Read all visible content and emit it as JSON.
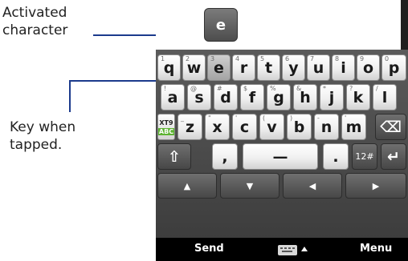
{
  "annotations": {
    "activated": [
      "Activated",
      "character"
    ],
    "key_tapped": [
      "Key when",
      "tapped."
    ]
  },
  "popup_char": "e",
  "keyboard": {
    "row1": [
      {
        "letter": "q",
        "num": "1"
      },
      {
        "letter": "w",
        "num": "2"
      },
      {
        "letter": "e",
        "num": "3"
      },
      {
        "letter": "r",
        "num": "4"
      },
      {
        "letter": "t",
        "num": "5"
      },
      {
        "letter": "y",
        "num": "6"
      },
      {
        "letter": "u",
        "num": "7"
      },
      {
        "letter": "i",
        "num": "8"
      },
      {
        "letter": "o",
        "num": "9"
      },
      {
        "letter": "p",
        "num": "0"
      }
    ],
    "row2": [
      {
        "letter": "a",
        "num": "!"
      },
      {
        "letter": "s",
        "num": "@"
      },
      {
        "letter": "d",
        "num": "#"
      },
      {
        "letter": "f",
        "num": "$"
      },
      {
        "letter": "g",
        "num": "%"
      },
      {
        "letter": "h",
        "num": "&"
      },
      {
        "letter": "j",
        "num": "*"
      },
      {
        "letter": "k",
        "num": "?"
      },
      {
        "letter": "l",
        "num": "/"
      }
    ],
    "row3": [
      {
        "letter": "z",
        "num": "_"
      },
      {
        "letter": "x",
        "num": "\""
      },
      {
        "letter": "c",
        "num": "'"
      },
      {
        "letter": "v",
        "num": "("
      },
      {
        "letter": "b",
        "num": ")"
      },
      {
        "letter": "n",
        "num": "-"
      },
      {
        "letter": "m",
        "num": "'"
      }
    ],
    "xt9_top": "XT9",
    "xt9_bottom": "ABC",
    "shift": "⇧",
    "comma": ",",
    "space": "—",
    "period": ".",
    "num_toggle": "12#",
    "enter": "↵",
    "backspace": "⌫",
    "arrows": {
      "up": "▲",
      "down": "▼",
      "left": "◀",
      "right": "▶"
    }
  },
  "softkeys": {
    "left": "Send",
    "right": "Menu"
  },
  "colors": {
    "leader": "#1b3a8c",
    "xt9_green": "#5db332"
  }
}
